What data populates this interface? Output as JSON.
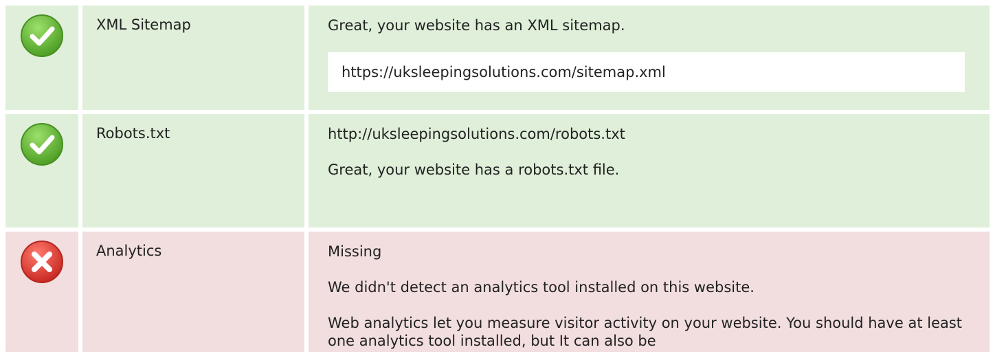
{
  "checks": [
    {
      "status": "pass",
      "icon": "check-icon",
      "label": "XML Sitemap",
      "message": "Great, your website has an XML sitemap.",
      "url": "https://uksleepingsolutions.com/sitemap.xml"
    },
    {
      "status": "pass",
      "icon": "check-icon",
      "label": "Robots.txt",
      "url": "http://uksleepingsolutions.com/robots.txt",
      "message": "Great, your website has a robots.txt file."
    },
    {
      "status": "fail",
      "icon": "cross-icon",
      "label": "Analytics",
      "value": "Missing",
      "message": "We didn't detect an analytics tool installed on this website.",
      "description": "Web analytics let you measure visitor activity on your website. You should have at least one analytics tool installed, but It can also be"
    }
  ],
  "colors": {
    "success_bg": "#dfefd9",
    "danger_bg": "#f2dedf",
    "success_icon": "#6cbf3a",
    "danger_icon": "#e0413a"
  }
}
